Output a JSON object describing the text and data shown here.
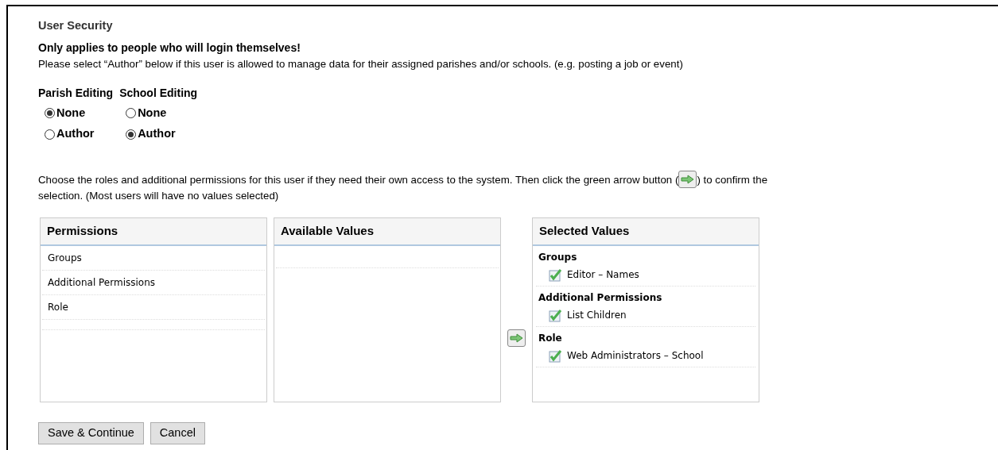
{
  "title": "User Security",
  "warning": "Only applies to people who will login themselves!",
  "note": "Please select “Author” below if this user is allowed to manage data for their assigned parishes and/or schools. (e.g. posting a job or event)",
  "editing": [
    {
      "heading": "Parish Editing",
      "options": [
        {
          "label": "None",
          "selected": true
        },
        {
          "label": "Author",
          "selected": false
        }
      ]
    },
    {
      "heading": "School Editing",
      "options": [
        {
          "label": "None",
          "selected": false
        },
        {
          "label": "Author",
          "selected": true
        }
      ]
    }
  ],
  "instructions": {
    "before": "Choose the roles and additional permissions for this user if they need their own access to the system. Then click the green arrow button (",
    "after": ") to confirm the",
    "continuation": "selection. (Most users will have no values selected)"
  },
  "permissions": {
    "heading": "Permissions",
    "items": [
      "Groups",
      "Additional Permissions",
      "Role"
    ]
  },
  "available": {
    "heading": "Available Values"
  },
  "selected_values": {
    "heading": "Selected Values",
    "groups": [
      {
        "name": "Groups",
        "items": [
          {
            "label": "Editor – Names",
            "checked": true
          }
        ]
      },
      {
        "name": "Additional Permissions",
        "items": [
          {
            "label": "List Children",
            "checked": true
          }
        ]
      },
      {
        "name": "Role",
        "items": [
          {
            "label": "Web Administrators – School",
            "checked": true
          }
        ]
      }
    ]
  },
  "buttons": [
    "Save & Continue",
    "Cancel"
  ]
}
